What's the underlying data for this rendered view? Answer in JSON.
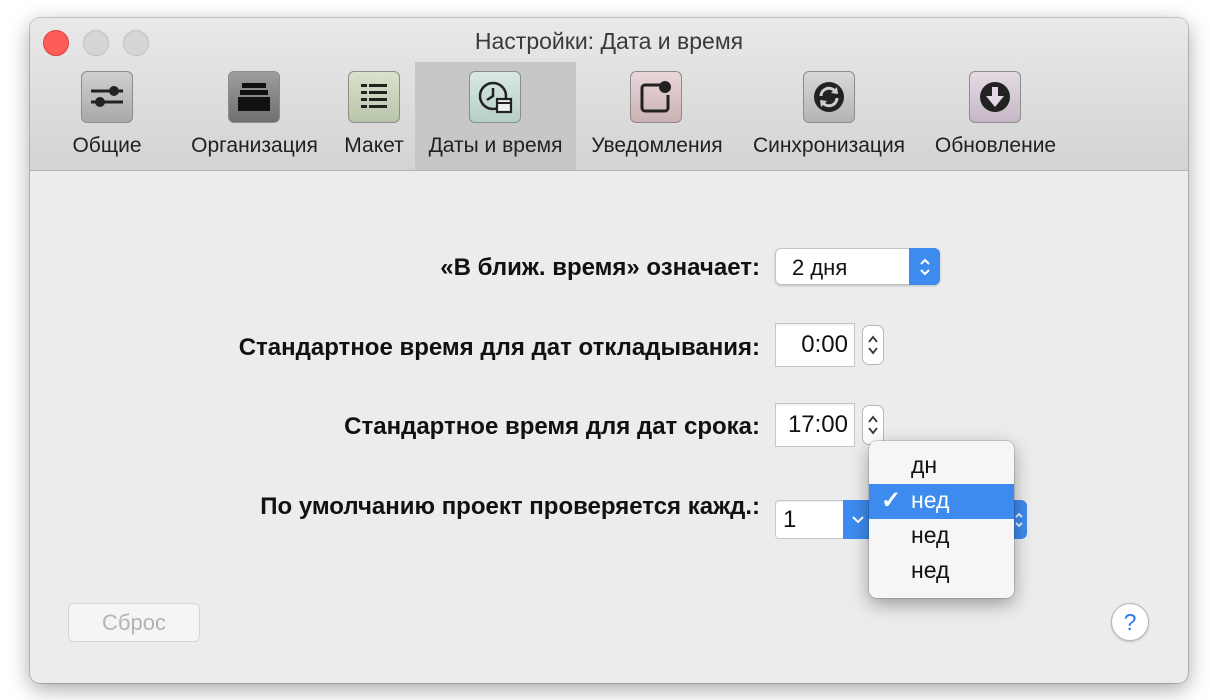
{
  "window": {
    "title": "Настройки: Дата и время"
  },
  "toolbar": {
    "items": [
      {
        "label": "Общие",
        "icon": "sliders-icon"
      },
      {
        "label": "Организация",
        "icon": "stack-icon"
      },
      {
        "label": "Макет",
        "icon": "layout-list-icon"
      },
      {
        "label": "Даты и время",
        "icon": "clock-calendar-icon",
        "selected": true
      },
      {
        "label": "Уведомления",
        "icon": "notification-badge-icon"
      },
      {
        "label": "Синхронизация",
        "icon": "sync-icon"
      },
      {
        "label": "Обновление",
        "icon": "download-icon"
      }
    ]
  },
  "settings": {
    "soon": {
      "label": "«В ближ. время» означает:",
      "value": "2 дня"
    },
    "defer_time": {
      "label": "Стандартное время для дат откладывания:",
      "value": "0:00"
    },
    "due_time": {
      "label": "Стандартное время для дат срока:",
      "value": "17:00"
    },
    "review": {
      "label": "По умолчанию проект проверяется кажд.:",
      "value": "1"
    }
  },
  "review_menu": {
    "items": [
      {
        "label": "дн",
        "checked": false
      },
      {
        "label": "нед",
        "checked": true
      },
      {
        "label": "нед",
        "checked": false
      },
      {
        "label": "нед",
        "checked": false
      }
    ],
    "check_mark": "✓"
  },
  "buttons": {
    "reset": "Сброс",
    "help": "?"
  },
  "colors": {
    "accent": "#3d8bef",
    "close": "#fc5b57"
  }
}
